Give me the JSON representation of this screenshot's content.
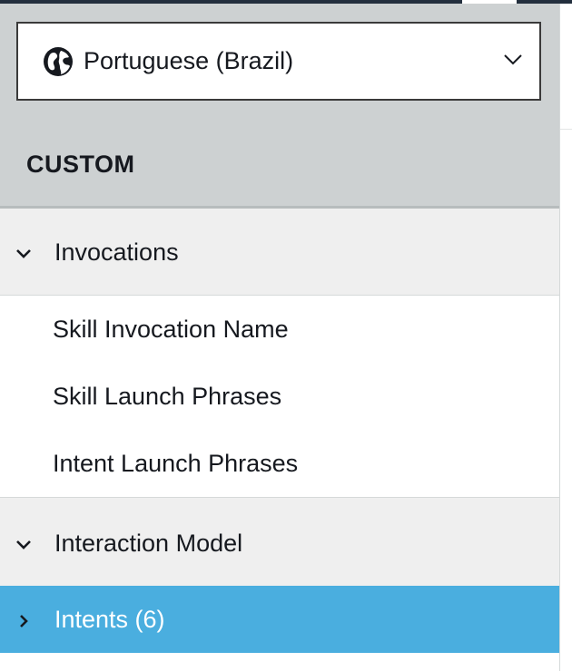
{
  "locale_selector": {
    "value": "Portuguese (Brazil)",
    "icon": "globe-icon"
  },
  "sidebar": {
    "section_title": "CUSTOM",
    "groups": [
      {
        "label": "Invocations",
        "expanded": true,
        "items": [
          {
            "label": "Skill Invocation Name"
          },
          {
            "label": "Skill Launch Phrases"
          },
          {
            "label": "Intent Launch Phrases"
          }
        ]
      },
      {
        "label": "Interaction Model",
        "expanded": true,
        "items": [
          {
            "label": "Intents (6)",
            "active": true
          }
        ]
      }
    ]
  },
  "colors": {
    "header_bg": "#cdd1d2",
    "group_bg": "#efefef",
    "active_bg": "#4aaedf",
    "topbar": "#232f3e"
  }
}
